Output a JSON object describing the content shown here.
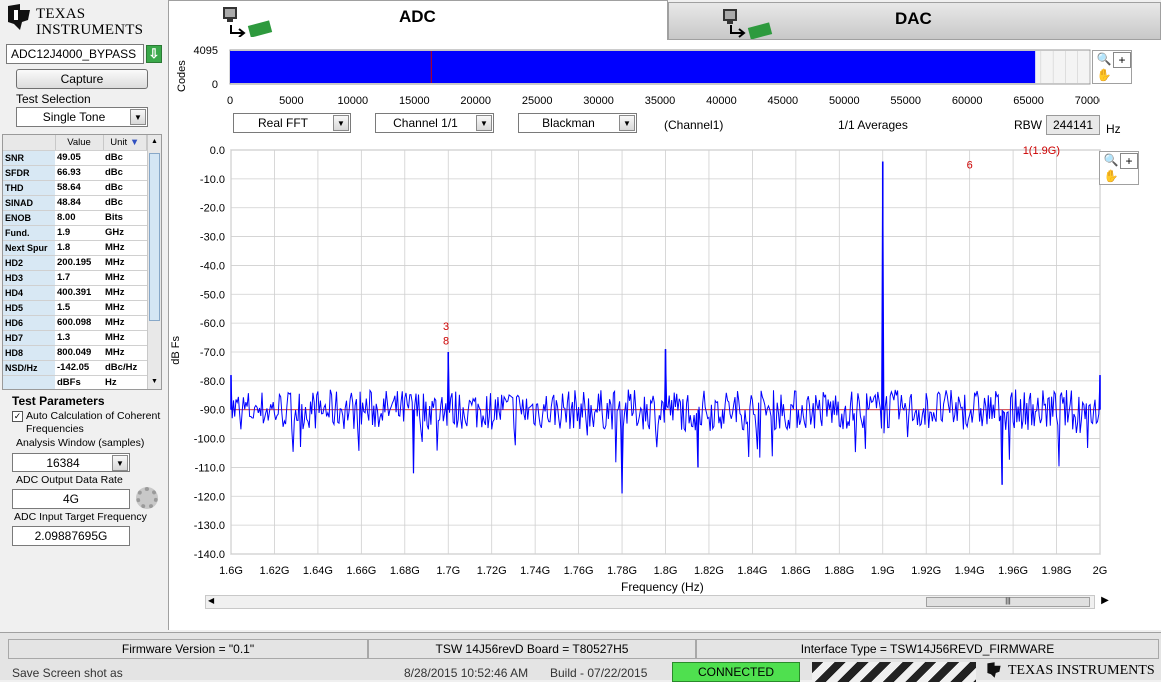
{
  "brand": {
    "logo_text_line1": "TEXAS",
    "logo_text_line2": "INSTRUMENTS",
    "bottom_logo_text": "TEXAS INSTRUMENTS"
  },
  "tabs": [
    {
      "label": "ADC",
      "active": true
    },
    {
      "label": "DAC",
      "active": false
    }
  ],
  "left": {
    "device": "ADC12J4000_BYPASS",
    "capture_label": "Capture",
    "test_selection_label": "Test Selection",
    "test_selection_value": "Single Tone",
    "metrics_headers": [
      "Value",
      "Unit"
    ],
    "metrics": [
      {
        "name": "SNR",
        "value": "49.05",
        "unit": "dBc"
      },
      {
        "name": "SFDR",
        "value": "66.93",
        "unit": "dBc"
      },
      {
        "name": "THD",
        "value": "58.64",
        "unit": "dBc"
      },
      {
        "name": "SINAD",
        "value": "48.84",
        "unit": "dBc"
      },
      {
        "name": "ENOB",
        "value": "8.00",
        "unit": "Bits"
      },
      {
        "name": "Fund.",
        "value": "1.9",
        "unit": "GHz"
      },
      {
        "name": "Next Spur",
        "value": "1.8",
        "unit": "MHz"
      },
      {
        "name": "HD2",
        "value": "200.195",
        "unit": "MHz"
      },
      {
        "name": "HD3",
        "value": "1.7",
        "unit": "MHz"
      },
      {
        "name": "HD4",
        "value": "400.391",
        "unit": "MHz"
      },
      {
        "name": "HD5",
        "value": "1.5",
        "unit": "MHz"
      },
      {
        "name": "HD6",
        "value": "600.098",
        "unit": "MHz"
      },
      {
        "name": "HD7",
        "value": "1.3",
        "unit": "MHz"
      },
      {
        "name": "HD8",
        "value": "800.049",
        "unit": "MHz"
      },
      {
        "name": "NSD/Hz",
        "value": "-142.05",
        "unit": "dBc/Hz"
      },
      {
        "name": "",
        "value": "dBFs",
        "unit": "Hz"
      }
    ],
    "test_params_title": "Test Parameters",
    "auto_calc_label": "Auto Calculation of Coherent Frequencies",
    "auto_calc_checked": true,
    "analysis_window_label": "Analysis Window (samples)",
    "analysis_window_value": "16384",
    "output_rate_label": "ADC Output Data Rate",
    "output_rate_value": "4G",
    "input_freq_label": "ADC Input Target Frequency",
    "input_freq_value": "2.09887695G"
  },
  "codes_plot": {
    "ylabel": "Codes",
    "ytick_top": "4095",
    "ytick_bottom": "0",
    "xticks": [
      "0",
      "5000",
      "10000",
      "15000",
      "20000",
      "25000",
      "30000",
      "35000",
      "40000",
      "45000",
      "50000",
      "55000",
      "60000",
      "65000",
      "70000"
    ],
    "fill_end_sample": 65536,
    "marker_sample": 16384
  },
  "controls": {
    "fft_type": "Real FFT",
    "channel": "Channel 1/1",
    "window": "Blackman",
    "channel_info": "(Channel1)",
    "averages": "1/1 Averages",
    "rbw_label": "RBW",
    "rbw_value": "244141",
    "rbw_unit": "Hz"
  },
  "chart_data": {
    "type": "line",
    "xlabel": "Frequency (Hz)",
    "ylabel": "dB Fs",
    "xlim": [
      1.6,
      2.0
    ],
    "ylim": [
      -140,
      0
    ],
    "xticks": [
      "1.6G",
      "1.62G",
      "1.64G",
      "1.66G",
      "1.68G",
      "1.7G",
      "1.72G",
      "1.74G",
      "1.76G",
      "1.78G",
      "1.8G",
      "1.82G",
      "1.84G",
      "1.86G",
      "1.88G",
      "1.9G",
      "1.92G",
      "1.94G",
      "1.96G",
      "1.98G",
      "2G"
    ],
    "yticks": [
      "0.0",
      "-10.0",
      "-20.0",
      "-30.0",
      "-40.0",
      "-50.0",
      "-60.0",
      "-70.0",
      "-80.0",
      "-90.0",
      "-100.0",
      "-110.0",
      "-120.0",
      "-130.0",
      "-140.0"
    ],
    "noise_floor_db": -90,
    "peaks": [
      {
        "x": 1.9,
        "y": -4
      },
      {
        "x": 1.8,
        "y": -69
      },
      {
        "x": 1.7,
        "y": -70
      },
      {
        "x": 1.6,
        "y": -78
      },
      {
        "x": 2.0,
        "y": -78
      }
    ],
    "dips": [
      {
        "x": 1.78,
        "y": -119
      },
      {
        "x": 1.955,
        "y": -116
      },
      {
        "x": 1.684,
        "y": -112
      },
      {
        "x": 1.815,
        "y": -110
      }
    ],
    "annotations": [
      {
        "text": "3",
        "x": 1.699,
        "y": -61
      },
      {
        "text": "8",
        "x": 1.699,
        "y": -66
      },
      {
        "text": "6",
        "x": 1.94,
        "y": -5
      },
      {
        "text": "1(1.9G)",
        "x": 1.973,
        "y": 0
      }
    ],
    "line_color": "#0000ff",
    "annotation_color": "#cc0000"
  },
  "status": {
    "firmware": "Firmware Version = \"0.1\"",
    "board": "TSW 14J56revD Board = T80527H5",
    "interface": "Interface Type = TSW14J56REVD_FIRMWARE",
    "save_shot": "Save Screen shot as",
    "datetime": "8/28/2015 10:52:46 AM",
    "build": "Build  - 07/22/2015",
    "connected": "CONNECTED"
  }
}
